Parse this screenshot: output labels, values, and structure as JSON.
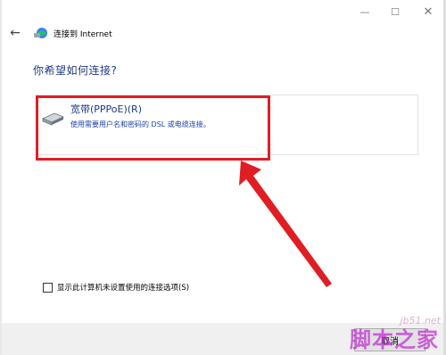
{
  "window": {
    "minimize_glyph": "—",
    "maximize_glyph": "☐",
    "close_glyph": "✕"
  },
  "titlebar": {
    "back_glyph": "←",
    "title": "连接到 Internet"
  },
  "heading": "你希望如何连接?",
  "option": {
    "title": "宽带(PPPoE)(R)",
    "description": "使用需要用户名和密码的 DSL 或电缆连接。"
  },
  "checkbox": {
    "label": "显示此计算机未设置使用的连接选项(S)",
    "checked": false
  },
  "footer": {
    "button_label": "取消"
  },
  "watermark": {
    "small": "jb51.net",
    "large": "脚本之家"
  },
  "colors": {
    "accent": "#1e3a8a",
    "highlight": "#e11d24",
    "watermark": "#c026d3"
  }
}
